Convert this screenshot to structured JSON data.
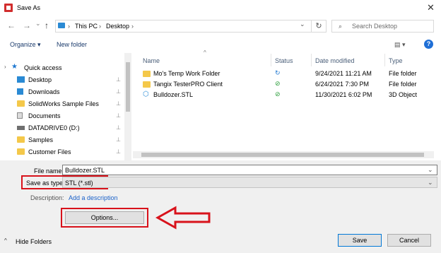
{
  "window": {
    "title": "Save As",
    "close_glyph": "✕"
  },
  "nav": {
    "back": "←",
    "forward": "→",
    "dropdown": "⌄",
    "up": "↑",
    "refresh": "↻"
  },
  "breadcrumb": {
    "root": "This PC",
    "folder": "Desktop",
    "sep": "›",
    "dropdown": "⌄"
  },
  "search": {
    "placeholder": "Search Desktop",
    "icon_glyph": "⌕"
  },
  "toolbar": {
    "organize_label": "Organize ▾",
    "new_folder_label": "New folder",
    "view_glyph": "▤ ▾",
    "help_glyph": "?"
  },
  "sidebar": {
    "items": [
      {
        "label": "Quick access",
        "icon": "star-icon",
        "pinned": false
      },
      {
        "label": "Desktop",
        "icon": "desktop-icon",
        "pinned": true
      },
      {
        "label": "Downloads",
        "icon": "download-icon",
        "pinned": true
      },
      {
        "label": "SolidWorks Sample Files",
        "icon": "folder-icon",
        "pinned": true
      },
      {
        "label": "Documents",
        "icon": "documents-icon",
        "pinned": true
      },
      {
        "label": "DATADRIVE0 (D:)",
        "icon": "drive-icon",
        "pinned": true
      },
      {
        "label": "Samples",
        "icon": "folder-icon",
        "pinned": true
      },
      {
        "label": "Customer Files",
        "icon": "folder-icon",
        "pinned": true
      }
    ],
    "pin_glyph": "📌"
  },
  "file_list": {
    "columns": [
      "Name",
      "Status",
      "Date modified",
      "Type"
    ],
    "sort_glyph": "^",
    "rows": [
      {
        "name": "Mo's Temp Work Folder",
        "status": "↻",
        "date": "9/24/2021 11:21 AM",
        "type": "File folder",
        "icon": "folder-icon",
        "status_icon": "sync-icon"
      },
      {
        "name": "Tangix TesterPRO Client",
        "status": "⊘",
        "date": "6/24/2021 7:30 PM",
        "type": "File folder",
        "icon": "folder-icon",
        "status_icon": "available-icon"
      },
      {
        "name": "Bulldozer.STL",
        "status": "⊘",
        "date": "11/30/2021 6:02 PM",
        "type": "3D Object",
        "icon": "3d-object-icon",
        "status_icon": "available-icon"
      }
    ]
  },
  "form": {
    "file_name_label": "File name:",
    "file_name_value": "Bulldozer.STL",
    "save_type_label": "Save as type:",
    "save_type_value": "STL (*.stl)",
    "description_label": "Description:",
    "description_link": "Add a description",
    "options_label": "Options...",
    "dropdown_glyph": "⌄"
  },
  "footer": {
    "hide_folders_label": "Hide Folders",
    "save_label": "Save",
    "cancel_label": "Cancel",
    "caret_glyph": "^"
  },
  "colors": {
    "annotation_red": "#d8121b",
    "accent_blue": "#1f6fd6",
    "folder_yellow": "#f4c84a"
  }
}
